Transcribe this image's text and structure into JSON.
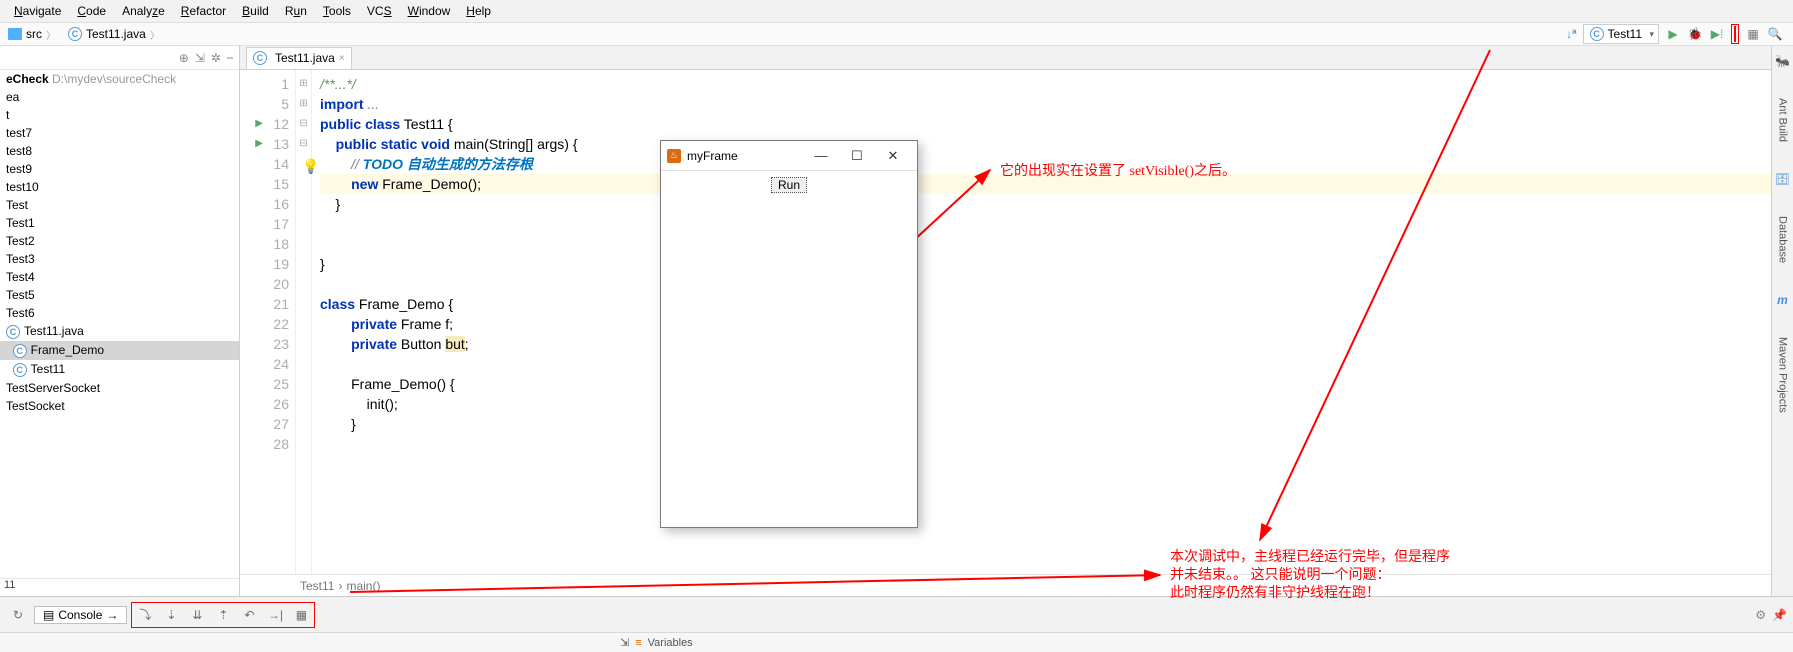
{
  "menu": {
    "items": [
      "Navigate",
      "Code",
      "Analyze",
      "Refactor",
      "Build",
      "Run",
      "Tools",
      "VCS",
      "Window",
      "Help"
    ]
  },
  "breadcrumb": {
    "src": "src",
    "file": "Test11.java"
  },
  "toolbar": {
    "run_config": "Test11",
    "sort_icon": "↓ª"
  },
  "project": {
    "root": "eCheck",
    "root_path": "D:\\mydev\\sourceCheck",
    "nodes": [
      "ea",
      "t",
      "test7",
      "test8",
      "test9",
      "test10",
      "Test",
      "Test1",
      "Test2",
      "Test3",
      "Test4",
      "Test5",
      "Test6",
      "Test11.java"
    ],
    "classes": [
      "Frame_Demo",
      "Test11"
    ],
    "tail": [
      "TestServerSocket",
      "TestSocket"
    ],
    "status": "11"
  },
  "editor": {
    "tab": "Test11.java",
    "lines": [
      {
        "n": 1,
        "fold": "⊞",
        "html": "<span class='cm-g'>/**...*/</span>"
      },
      {
        "n": 5,
        "fold": "⊞",
        "html": "<span class='kw'>import</span> <span class='cm'>...</span>"
      },
      {
        "n": 12,
        "fold": "⊟",
        "run": true,
        "html": "<span class='kw'>public</span> <span class='kw'>class</span> Test11 {"
      },
      {
        "n": 13,
        "fold": "⊟",
        "run": true,
        "html": "    <span class='kw'>public</span> <span class='kw'>static</span> <span class='kw'>void</span> main(String[] args) {"
      },
      {
        "n": 14,
        "html": "        <span class='cm'>// </span><span class='todo'>TODO</span> <span class='cm todo'>自动生成的方法存根</span>"
      },
      {
        "n": 15,
        "hl": true,
        "html": "        <span class='kw'>new</span> Frame_Demo();"
      },
      {
        "n": 16,
        "html": "    }"
      },
      {
        "n": 17,
        "html": ""
      },
      {
        "n": 18,
        "html": ""
      },
      {
        "n": 19,
        "html": "}"
      },
      {
        "n": 20,
        "html": ""
      },
      {
        "n": 21,
        "html": "<span class='kw'>class</span> Frame_Demo {"
      },
      {
        "n": 22,
        "html": "        <span class='kw'>private</span> Frame f;"
      },
      {
        "n": 23,
        "html": "        <span class='kw'>private</span> Button <span class='warn-u'>but</span>;"
      },
      {
        "n": 24,
        "html": ""
      },
      {
        "n": 25,
        "html": "        Frame_Demo() {"
      },
      {
        "n": 26,
        "html": "            init();"
      },
      {
        "n": 27,
        "html": "        }"
      },
      {
        "n": 28,
        "html": ""
      }
    ],
    "crumb1": "Test11",
    "crumb2": "main()"
  },
  "myframe": {
    "title": "myFrame",
    "button": "Run"
  },
  "annotations": {
    "a1": "它的出现实在设置了  setVisible()之后。",
    "a2": "本次调试中，主线程已经运行完毕，但是程序",
    "a3": "并未结束。。  这只能说明一个问题：",
    "a4": "此时程序仍然有非守护线程在跑！"
  },
  "right": {
    "ant": "Ant Build",
    "db": "Database",
    "maven": "Maven Projects"
  },
  "bottom": {
    "console": "Console",
    "variables": "Variables"
  }
}
